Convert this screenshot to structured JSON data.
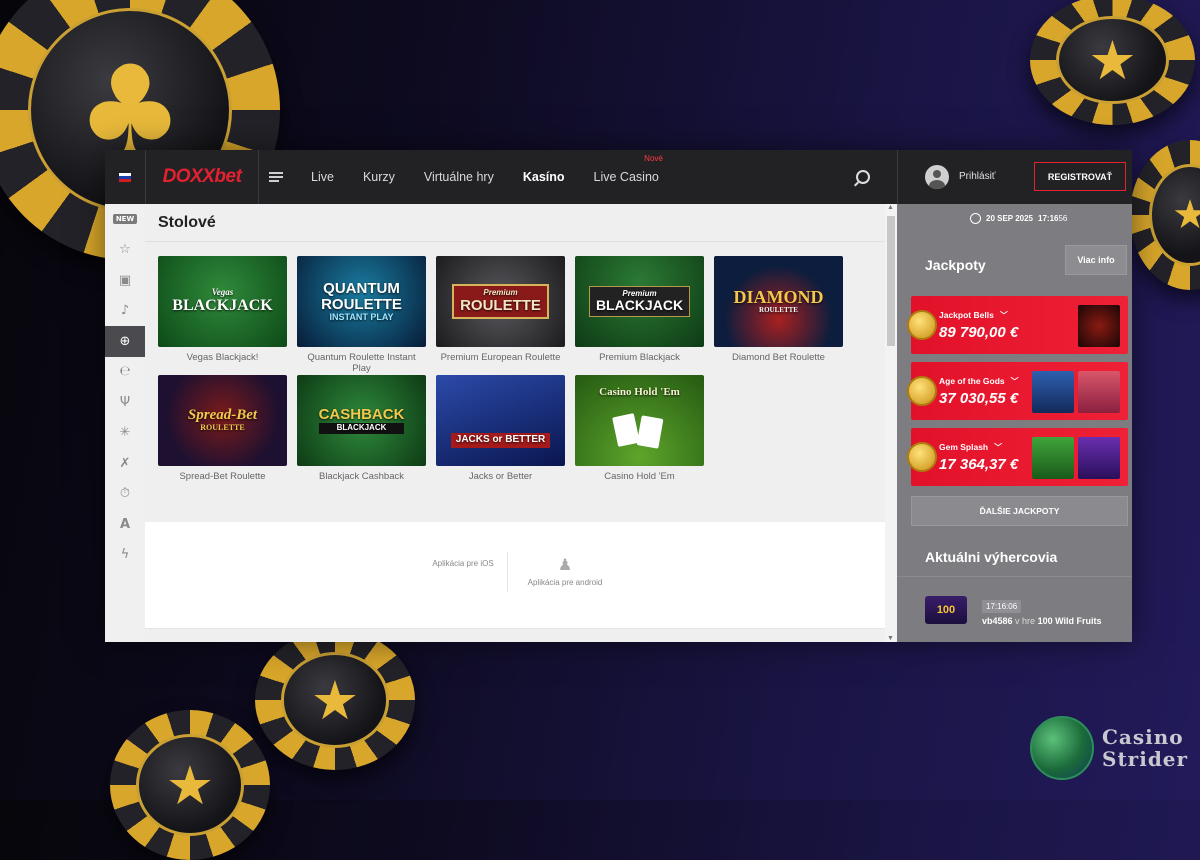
{
  "header": {
    "logo": "DOXXbet",
    "nav": [
      {
        "label": "Live",
        "active": false
      },
      {
        "label": "Kurzy",
        "active": false
      },
      {
        "label": "Virtuálne hry",
        "active": false
      },
      {
        "label": "Kasíno",
        "active": true
      },
      {
        "label": "Live Casino",
        "active": false,
        "badge": "Nové"
      }
    ],
    "login_label": "Prihlásiť",
    "register_label": "REGISTROVAŤ"
  },
  "sidebar": {
    "new_badge": "NEW",
    "icons": [
      "star-icon",
      "slot-machine-icon",
      "bell-icon",
      "roulette-icon",
      "e-icon",
      "wing-icon",
      "sparkle-icon",
      "x-icon",
      "clock-icon",
      "a-icon",
      "bolt-icon"
    ],
    "active_index": 4
  },
  "main": {
    "section_title": "Stolové",
    "games": [
      {
        "name": "Vegas Blackjack!",
        "thumb_text": "BLACKJACK",
        "thumb_sub": "Vegas"
      },
      {
        "name": "Quantum Roulette Instant Play",
        "thumb_text": "QUANTUM ROULETTE",
        "thumb_sub": "INSTANT PLAY"
      },
      {
        "name": "Premium European Roulette",
        "thumb_text": "ROULETTE",
        "thumb_sub": "Premium"
      },
      {
        "name": "Premium Blackjack",
        "thumb_text": "BLACKJACK",
        "thumb_sub": "Premium"
      },
      {
        "name": "Diamond Bet Roulette",
        "thumb_text": "DIAMOND",
        "thumb_sub": "ROULETTE"
      },
      {
        "name": "Spread-Bet Roulette",
        "thumb_text": "Spread-Bet",
        "thumb_sub": "ROULETTE"
      },
      {
        "name": "Blackjack Cashback",
        "thumb_text": "CASHBACK",
        "thumb_sub": "BLACKJACK"
      },
      {
        "name": "Jacks or Better",
        "thumb_text": "JACKS or BETTER",
        "thumb_sub": ""
      },
      {
        "name": "Casino Hold 'Em",
        "thumb_text": "Casino Hold 'Em",
        "thumb_sub": ""
      }
    ],
    "apps": [
      {
        "label": "Aplikácia pre iOS",
        "icon": "apple-icon"
      },
      {
        "label": "Aplikácia pre android",
        "icon": "android-icon"
      }
    ]
  },
  "rightpanel": {
    "date": "20 SEP 2025",
    "time": "17:16",
    "seconds": "56",
    "jackpots_title": "Jackpoty",
    "more_info": "Viac info",
    "jackpots": [
      {
        "name": "Jackpot Bells",
        "amount": "89 790,00 €"
      },
      {
        "name": "Age of the Gods",
        "amount": "37 030,55 €"
      },
      {
        "name": "Gem Splash",
        "amount": "17 364,37 €"
      }
    ],
    "more_jackpots": "ĎALŠIE JACKPOTY",
    "winners_title": "Aktuálni výhercovia",
    "winner": {
      "time": "17:16:06",
      "user": "vb4586",
      "in": "v hre",
      "game": "100 Wild Fruits",
      "thumb": "100"
    }
  },
  "watermark": {
    "line1": "Casino",
    "line2": "Strider"
  }
}
